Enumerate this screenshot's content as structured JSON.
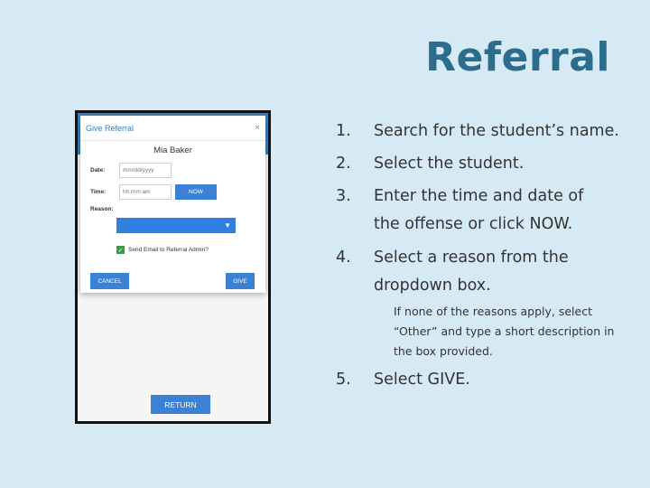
{
  "slide": {
    "title": "Referral"
  },
  "dialog": {
    "title": "Give Referral",
    "close_glyph": "×",
    "student_name": "Mia Baker",
    "date_label": "Date:",
    "date_placeholder": "mm/dd/yyyy",
    "time_label": "Time:",
    "time_placeholder": "hh:mm am",
    "now_label": "NOW",
    "reason_label": "Reason:",
    "reason_value": "",
    "dropdown_glyph": "▼",
    "send_email_label": "Send Email to Referral Admin?",
    "send_email_checked": true,
    "cancel_label": "CANCEL",
    "give_label": "GIVE"
  },
  "screen": {
    "return_label": "RETURN"
  },
  "steps": [
    {
      "num": "1.",
      "text": "Search for the student’s name."
    },
    {
      "num": "2.",
      "text": "Select the student."
    },
    {
      "num": "3.",
      "text": "Enter the time and date of the offense or click NOW."
    },
    {
      "num": "4.",
      "text": "Select a reason from the dropdown box."
    },
    {
      "num": "5.",
      "text": "Select GIVE."
    }
  ],
  "note": "If none of the reasons apply, select “Other” and type a short description in the box provided.",
  "colors": {
    "accent": "#3b82d6",
    "title": "#2c6c8c",
    "background": "#d6eaf5"
  }
}
